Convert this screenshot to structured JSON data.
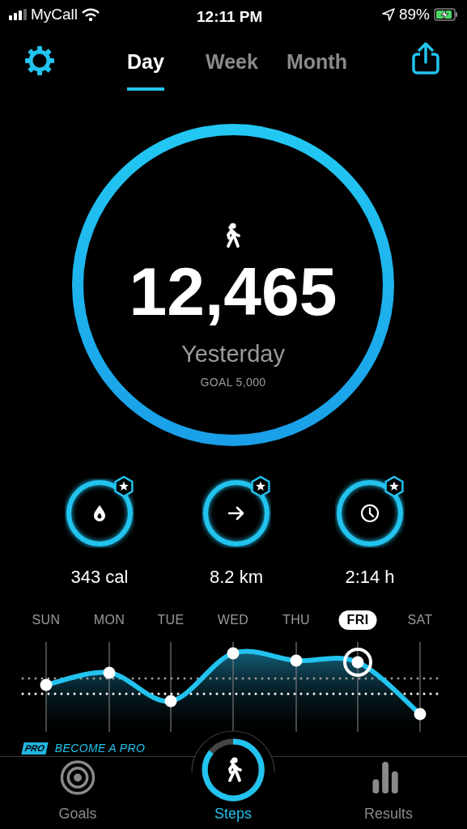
{
  "status_bar": {
    "carrier": "MyCall",
    "time": "12:11 PM",
    "battery": "89%"
  },
  "tabs": [
    {
      "label": "Day",
      "selected": true
    },
    {
      "label": "Week",
      "selected": false
    },
    {
      "label": "Month",
      "selected": false
    }
  ],
  "summary": {
    "steps": "12,465",
    "day": "Yesterday",
    "goal": "GOAL 5,000"
  },
  "stats": [
    {
      "kind": "calories",
      "value": "343 cal",
      "starred": true
    },
    {
      "kind": "distance",
      "value": "8.2 km",
      "starred": true
    },
    {
      "kind": "time",
      "value": "2:14 h",
      "starred": true
    }
  ],
  "days": [
    {
      "label": "SUN",
      "selected": false
    },
    {
      "label": "MON",
      "selected": false
    },
    {
      "label": "TUE",
      "selected": false
    },
    {
      "label": "WED",
      "selected": false
    },
    {
      "label": "THU",
      "selected": false
    },
    {
      "label": "FRI",
      "selected": true
    },
    {
      "label": "SAT",
      "selected": false
    }
  ],
  "promo": {
    "badge": "PRO",
    "text": "BECOME A PRO"
  },
  "bottom_tabs": [
    {
      "kind": "goals",
      "label": "Goals",
      "selected": false
    },
    {
      "kind": "steps",
      "label": "Steps",
      "selected": true
    },
    {
      "kind": "results",
      "label": "Results",
      "selected": false
    }
  ]
}
